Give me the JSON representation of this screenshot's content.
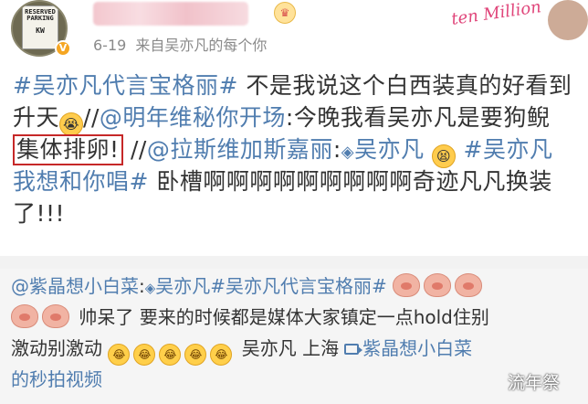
{
  "header": {
    "avatar_sign": {
      "line1": "RESERVED",
      "line2": "PARKING",
      "line3": "KW"
    },
    "date": "6-19",
    "source": "来自吴亦凡的每个你",
    "brand_overlay": "ten Million"
  },
  "post": {
    "line1": {
      "topic": "#吴亦凡代言宝格丽#",
      "text": " 不是我说这个白西装真的好看到"
    },
    "line2": {
      "text_a": "升天",
      "text_b": "//",
      "mention": "@明年维秘你开场",
      "text_c": ":今晚我看吴亦凡是要狗鲵"
    },
    "line3": {
      "boxed": "集体排卵!",
      "text_a": " //",
      "mention": "@拉斯维加斯嘉丽",
      "text_b": ":",
      "mention2": "吴亦凡",
      "topic": "#吴亦凡"
    },
    "line4": {
      "topic": "我想和你唱#",
      "text": " 卧槽啊啊啊啊啊啊啊啊啊奇迹凡凡换装"
    },
    "line5": {
      "text": "了!!!"
    }
  },
  "repost": {
    "line1": {
      "mention": "@紫晶想小白菜",
      "text_a": ":",
      "mention2": "吴亦凡",
      "topic": "#吴亦凡代言宝格丽#"
    },
    "line2": {
      "text": " 帅呆了 要来的时候都是媒体大家镇定一点hold住别"
    },
    "line3": {
      "text": "激动别激动",
      "location": "吴亦凡 上海",
      "video_user": "紫晶想小白菜"
    },
    "line4": {
      "text": "的秒拍视频"
    }
  },
  "watermark": "流年祭",
  "colors": {
    "link": "#507daf",
    "highlight_box": "#c62828",
    "meta": "#8a8a8a"
  }
}
